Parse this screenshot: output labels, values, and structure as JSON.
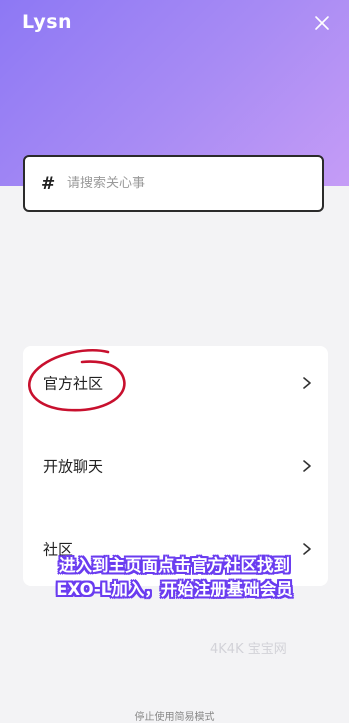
{
  "header": {
    "logo_text": "Lysn",
    "close_icon": "close-icon",
    "gradient_colors": [
      "#8d78f4",
      "#c59cf6"
    ]
  },
  "search": {
    "prefix_symbol": "#",
    "placeholder": "请搜索关心事",
    "value": ""
  },
  "menu": {
    "items": [
      {
        "label": "官方社区",
        "icon": "chevron-right-icon"
      },
      {
        "label": "开放聊天",
        "icon": "chevron-right-icon"
      },
      {
        "label": "社区",
        "icon": "chevron-right-icon"
      }
    ]
  },
  "annotation": {
    "circle_color": "#c8102e"
  },
  "overlay": {
    "subtitle_line1": "进入到主页面点击官方社区找到",
    "subtitle_line2": "EXO-L加入，开始注册基础会员",
    "watermark": "4K4K 宝宝网",
    "outline_color": "#6a3cf0"
  },
  "footer": {
    "text": "停止使用简易模式"
  }
}
